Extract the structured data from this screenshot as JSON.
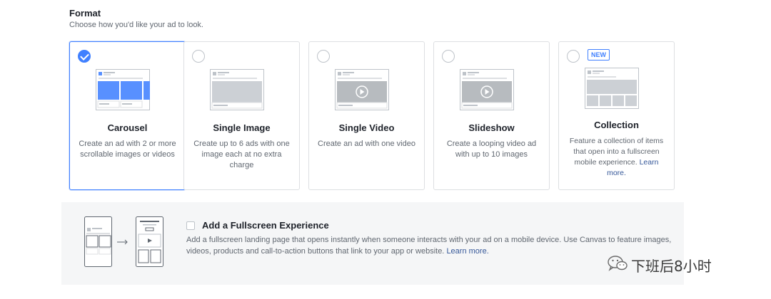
{
  "format": {
    "title": "Format",
    "subtitle": "Choose how you'd like your ad to look."
  },
  "cards": [
    {
      "title": "Carousel",
      "description": "Create an ad with 2 or more scrollable images or videos",
      "selected": true
    },
    {
      "title": "Single Image",
      "description": "Create up to 6 ads with one image each at no extra charge",
      "selected": false
    },
    {
      "title": "Single Video",
      "description": "Create an ad with one video",
      "selected": false
    },
    {
      "title": "Slideshow",
      "description": "Create a looping video ad with up to 10 images",
      "selected": false
    },
    {
      "title": "Collection",
      "description": "Feature a collection of items that open into a fullscreen mobile experience.",
      "link": "Learn more.",
      "badge": "NEW",
      "selected": false
    }
  ],
  "fullscreen": {
    "title": "Add a Fullscreen Experience",
    "description": "Add a fullscreen landing page that opens instantly when someone interacts with your ad on a mobile device. Use Canvas to feature images, videos, products and call-to-action buttons that link to your app or website.",
    "link": "Learn more.",
    "checked": false
  },
  "watermark": {
    "text": "下班后8小时",
    "icon": "wechat-icon"
  },
  "colors": {
    "accent": "#4080ff",
    "link": "#365899",
    "border": "#dddfe2",
    "panel": "#f5f6f7",
    "muted": "#606770"
  }
}
